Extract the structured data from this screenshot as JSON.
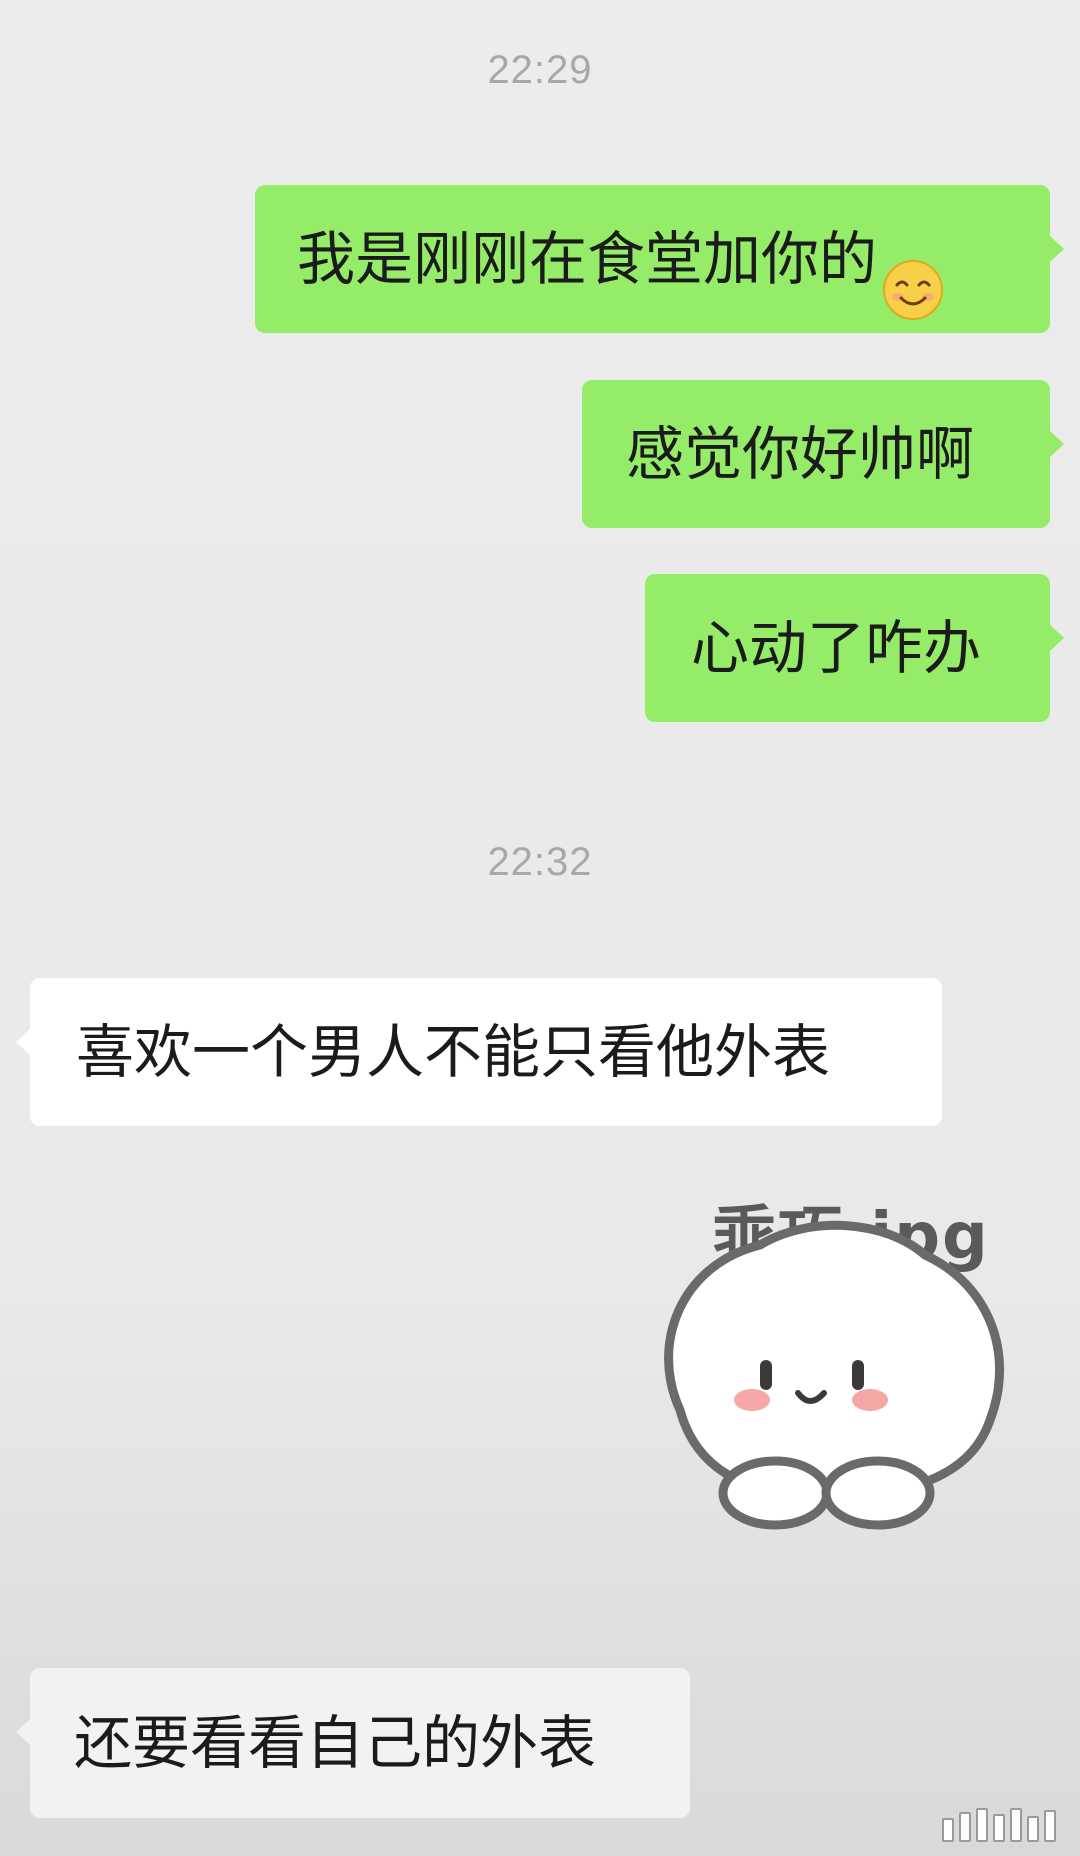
{
  "messages": [
    {
      "type": "timestamp",
      "text": "22:29"
    },
    {
      "type": "sent",
      "text": "我是刚刚在食堂加你的",
      "emoji": "smiling-face-emoji"
    },
    {
      "type": "sent",
      "text": "感觉你好帅啊"
    },
    {
      "type": "sent",
      "text": "心动了咋办"
    },
    {
      "type": "timestamp",
      "text": "22:32"
    },
    {
      "type": "received",
      "text": "喜欢一个男人不能只看他外表"
    },
    {
      "type": "sticker",
      "caption": "乖巧.jpg",
      "icon": "cute-blob-sticker"
    },
    {
      "type": "received",
      "text": "还要看看自己的外表"
    }
  ],
  "colors": {
    "background": "#ececec",
    "sent_bubble": "#95ec69",
    "received_bubble": "#ffffff",
    "timestamp": "#a8a8a8",
    "text": "#1b1b1b"
  }
}
